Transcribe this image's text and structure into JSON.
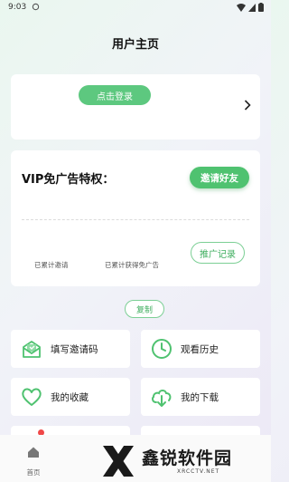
{
  "status_bar": {
    "time": "9:03"
  },
  "page": {
    "title": "用户主页"
  },
  "login_card": {
    "login_label": "点击登录"
  },
  "vip_card": {
    "title": "VIP免广告特权：",
    "invite_label": "邀请好友",
    "stat_invited_label": "已累计邀请",
    "stat_adfree_label": "已累计获得免广告",
    "promo_record_label": "推广记录"
  },
  "copy_label": "复制",
  "menu": {
    "items": [
      {
        "label": "填写邀请码",
        "icon": "invite-code-icon"
      },
      {
        "label": "观看历史",
        "icon": "clock-icon"
      },
      {
        "label": "我的收藏",
        "icon": "heart-icon"
      },
      {
        "label": "我的下载",
        "icon": "cloud-download-icon"
      }
    ]
  },
  "bottom_nav": {
    "home_label": "首页"
  },
  "watermark": {
    "text": "鑫锐软件园",
    "sub": "XRCCTV.NET"
  },
  "colors": {
    "accent": "#4fc270",
    "notification": "#f04848"
  }
}
